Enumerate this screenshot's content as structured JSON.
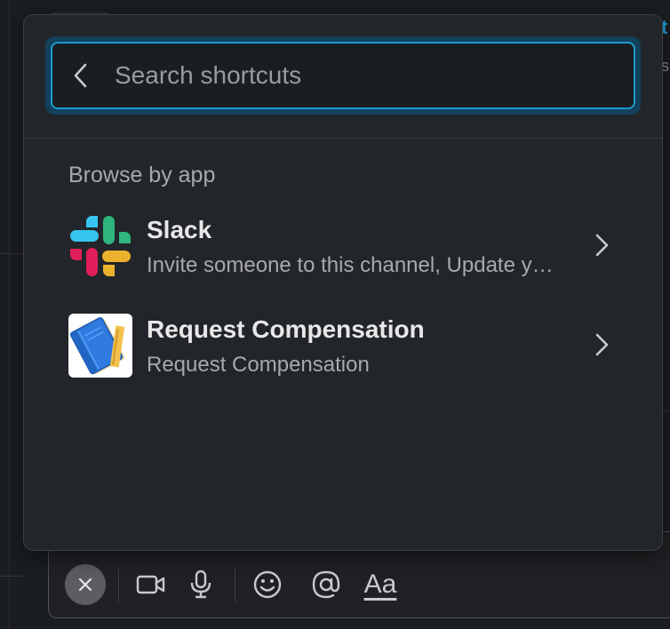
{
  "search": {
    "placeholder": "Search shortcuts",
    "value": ""
  },
  "browse": {
    "section_label": "Browse by app",
    "apps": [
      {
        "name": "Slack",
        "description": "Invite someone to this channel, Update y…",
        "icon": "slack-logo-icon"
      },
      {
        "name": "Request Compensation",
        "description": "Request Compensation",
        "icon": "blue-book-app-icon"
      }
    ]
  },
  "composer": {
    "format_label": "Aa",
    "icons": [
      "close-icon",
      "video-icon",
      "microphone-icon",
      "emoji-icon",
      "mention-icon",
      "formatting-icon"
    ]
  },
  "background": {
    "partial_text_1": "t",
    "partial_text_2": "s."
  },
  "colors": {
    "accent": "#1d9bd1",
    "popup_bg": "#222529",
    "app_bg": "#1a1d21",
    "slack_blue": "#36c5f0",
    "slack_green": "#2eb67d",
    "slack_red": "#e01e5a",
    "slack_yellow": "#ecb22e"
  }
}
